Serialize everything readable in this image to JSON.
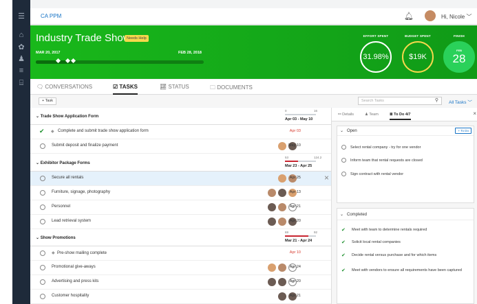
{
  "brand": "CA PPM",
  "user": {
    "greeting": "Hi, Nicole"
  },
  "project": {
    "title": "Industry Trade Show",
    "badge": "Needs Help",
    "start_date": "MAR 20, 2017",
    "end_date": "FEB 28, 2018",
    "timeline_progress": 0.22,
    "metrics": {
      "effort_label": "EFFORT SPENT",
      "effort_value": "31.98%",
      "budget_label": "BUDGET SPENT",
      "budget_value": "$19K",
      "finish_label": "FINISH",
      "finish_month": "FEB",
      "finish_day": "28"
    }
  },
  "tabs": [
    {
      "label": "CONVERSATIONS"
    },
    {
      "label": "TASKS"
    },
    {
      "label": "STATUS"
    },
    {
      "label": "DOCUMENTS"
    }
  ],
  "toolbar": {
    "add_task": "+ Task",
    "search_placeholder": "Search Tasks",
    "filter": "All Tasks"
  },
  "groups": [
    {
      "name": "Trade Show Application Form",
      "min": "0",
      "max": "16",
      "range": "Apr 03 - May 10",
      "progress": 0.0
    },
    {
      "name": "Exhibitor Package Forms",
      "min": "53",
      "max": "124.2",
      "range": "Mar 23 - Apr 25",
      "progress": 0.43
    },
    {
      "name": "Show Promotions",
      "min": "69",
      "max": "92",
      "range": "Mar 21 - Apr 24",
      "progress": 0.75
    }
  ],
  "tasks": [
    {
      "label": "Complete and submit trade show application form",
      "date": "Apr 03"
    },
    {
      "label": "Submit deposit and finalize payment",
      "date": "May 10"
    },
    {
      "label": "Secure all rentals",
      "date": "Apr 25"
    },
    {
      "label": "Furniture, signage, photography",
      "date": "Apr 13"
    },
    {
      "label": "Personnel",
      "date": "Apr 21",
      "plus": "+2"
    },
    {
      "label": "Lead retrieval system",
      "date": "Apr 20"
    },
    {
      "label": "Pre-show mailing complete",
      "date": "Apr 10"
    },
    {
      "label": "Promotional give-aways",
      "date": "Apr 24",
      "plus": "+2"
    },
    {
      "label": "Advertising and press kits",
      "date": "Apr 20",
      "plus": "+2"
    },
    {
      "label": "Customer hospitality",
      "date": "Apr 21"
    }
  ],
  "panel": {
    "tabs": {
      "details": "Details",
      "team": "Team",
      "todo": "To Do 4/7"
    },
    "open_title": "Open",
    "add_todo": "+ To Do",
    "open_items": [
      "Select rental company - try for one vendor",
      "Inform team that rental requests are closed",
      "Sign contract with rental vendor"
    ],
    "completed_title": "Completed",
    "completed_items": [
      "Meet with team to determine rentals required",
      "Solicit local rental companies",
      "Decide rental versus purchase and for which items",
      "Meet with vendors to ensure all requirements have been captured"
    ]
  }
}
